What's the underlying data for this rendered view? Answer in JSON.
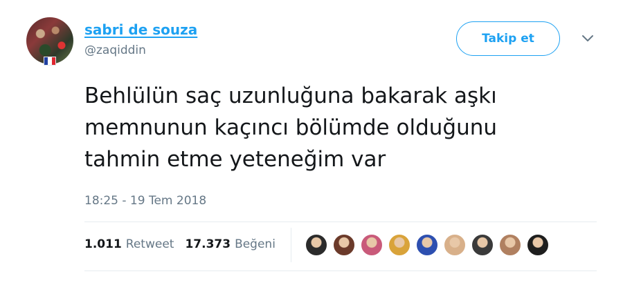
{
  "author": {
    "display_name": "sabri de souza",
    "handle": "@zaqiddin",
    "flag": "france-flag-icon"
  },
  "follow_button": {
    "label": "Takip et"
  },
  "menu": {
    "icon": "chevron-down-icon"
  },
  "tweet": {
    "lines": [
      "Behlülün saç uzunluğuna bakarak aşkı",
      "memnunun kaçıncı bölümde olduğunu",
      "tahmin etme yeteneğim var"
    ],
    "timestamp": "18:25 - 19 Tem 2018"
  },
  "stats": {
    "retweets": {
      "count": "1.011",
      "label": "Retweet"
    },
    "likes": {
      "count": "17.373",
      "label": "Beğeni"
    }
  },
  "likers": [
    {
      "color": "#2b2b2b"
    },
    {
      "color": "#6b3a2a"
    },
    {
      "color": "#c95a7a"
    },
    {
      "color": "#d9a33a"
    },
    {
      "color": "#2d4fb0"
    },
    {
      "color": "#d8b08a"
    },
    {
      "color": "#3a3a3a"
    },
    {
      "color": "#b08060"
    },
    {
      "color": "#1e1e1e"
    }
  ],
  "colors": {
    "accent": "#1da1f2",
    "text": "#14171a",
    "muted": "#657786"
  }
}
